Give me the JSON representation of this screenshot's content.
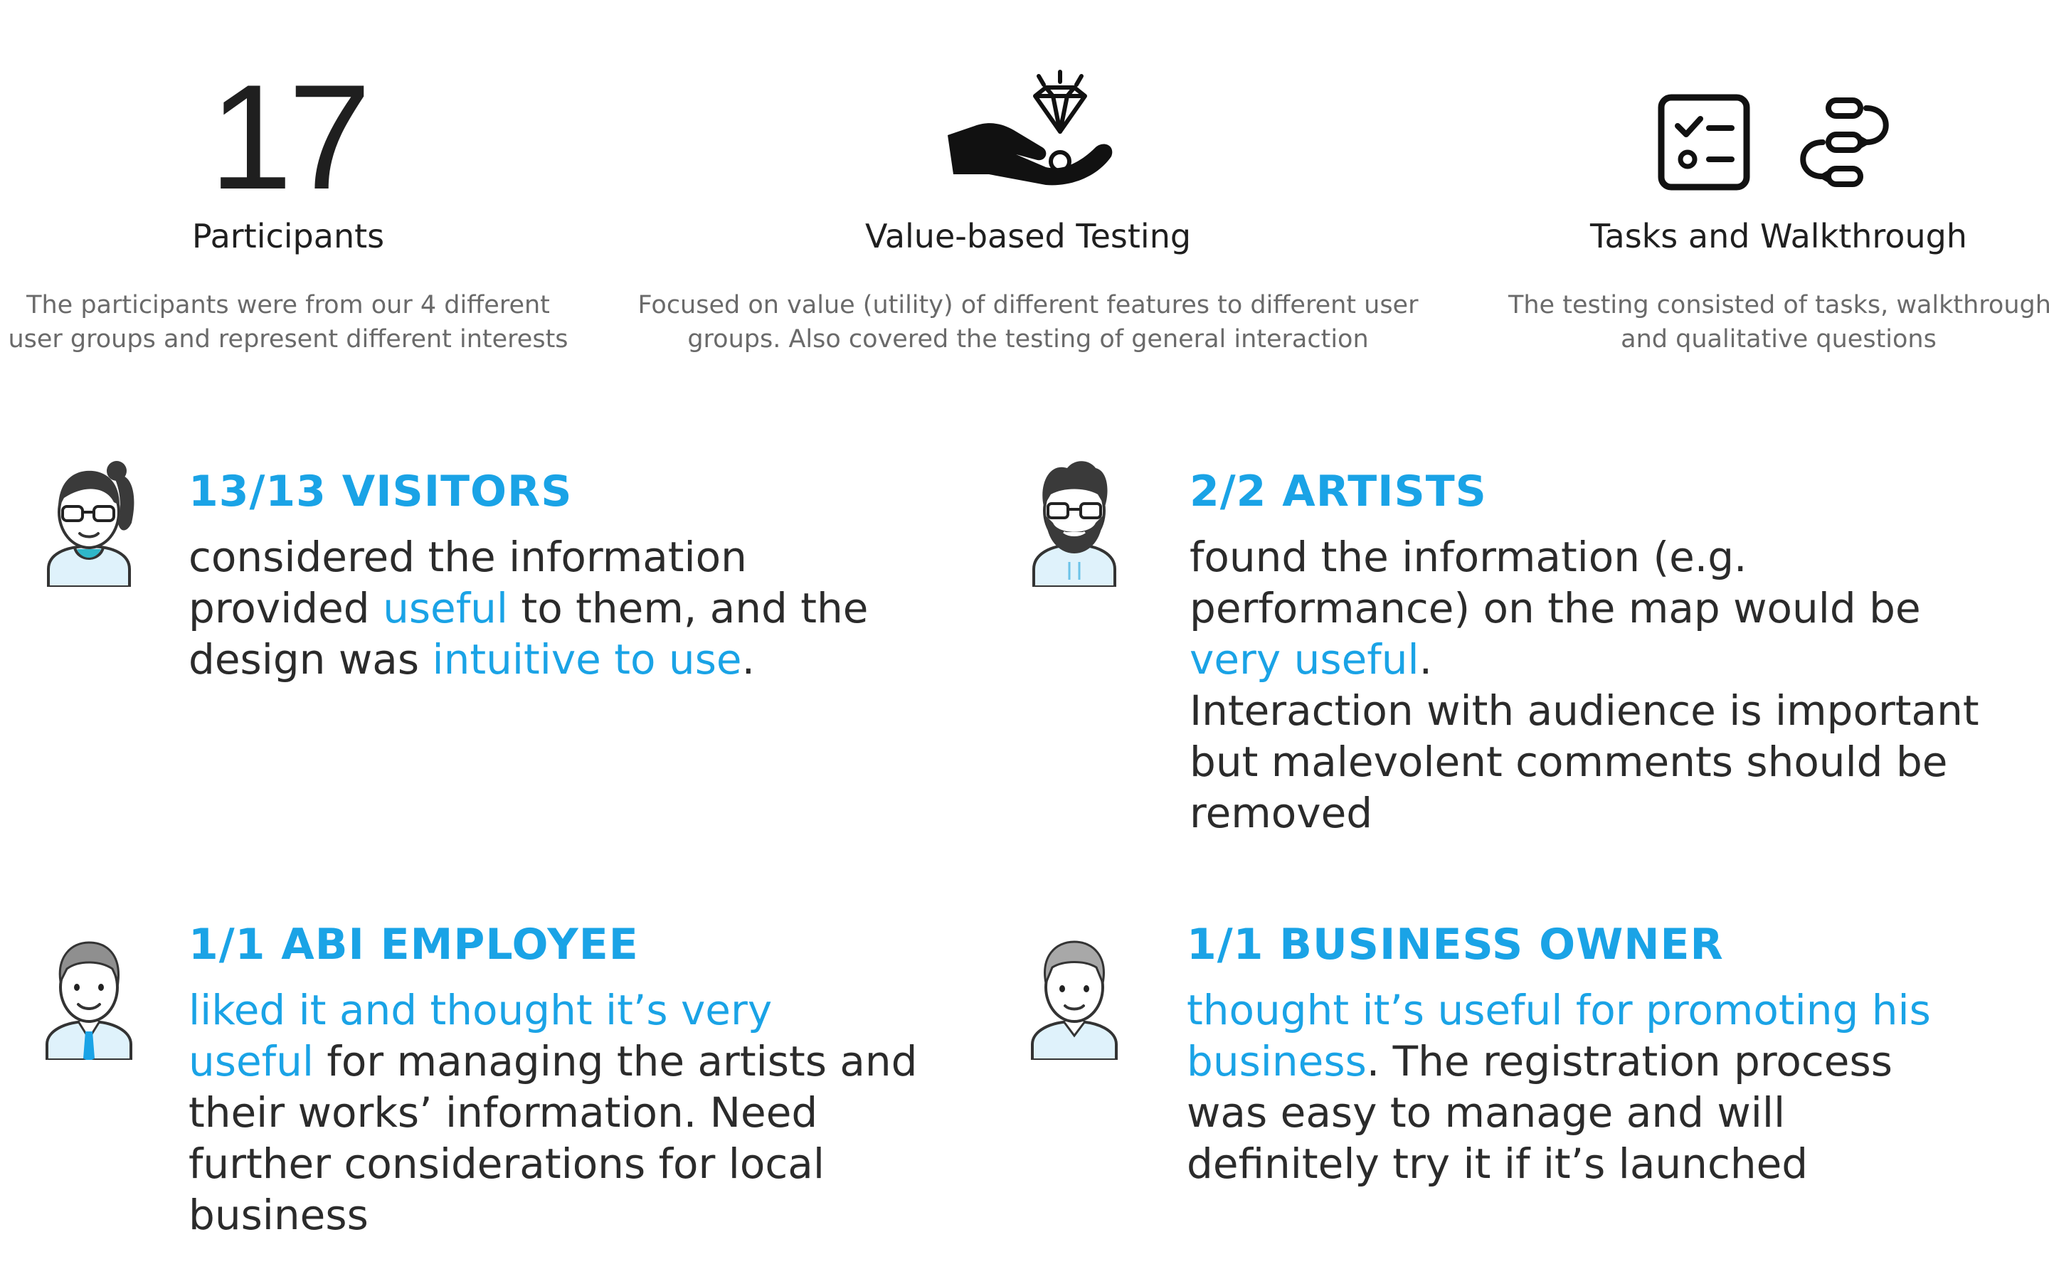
{
  "stats": [
    {
      "number": "17",
      "title": "Participants",
      "desc_lines": [
        "The participants were from our 4 different",
        "user groups and represent different interests"
      ]
    },
    {
      "icon": "hand-diamond-icon",
      "title": "Value-based Testing",
      "desc_lines": [
        "Focused on value (utility) of different features to different user",
        "groups. Also covered the testing of general interaction"
      ]
    },
    {
      "icon": "checklist-icon",
      "icon2": "flow-icon",
      "title": "Tasks and Walkthrough",
      "desc_lines": [
        "The testing consisted of tasks, walkthrough",
        "and qualitative questions"
      ]
    }
  ],
  "cards": [
    {
      "avatar": "woman-avatar-icon",
      "heading": "13/13 VISITORS",
      "lines": [
        [
          {
            "t": "considered the information"
          }
        ],
        [
          {
            "t": "provided "
          },
          {
            "t": "useful",
            "hl": true
          },
          {
            "t": " to them, and the"
          }
        ],
        [
          {
            "t": "design was "
          },
          {
            "t": "intuitive to use",
            "hl": true
          },
          {
            "t": "."
          }
        ]
      ]
    },
    {
      "avatar": "bearded-man-avatar-icon",
      "heading": "2/2 ARTISTS",
      "lines": [
        [
          {
            "t": "found the information (e.g."
          }
        ],
        [
          {
            "t": "performance) on the map would be"
          }
        ],
        [
          {
            "t": "very useful",
            "hl": true
          },
          {
            "t": "."
          }
        ],
        [
          {
            "t": "Interaction with audience is important"
          }
        ],
        [
          {
            "t": "but malevolent comments should be"
          }
        ],
        [
          {
            "t": "removed"
          }
        ]
      ]
    },
    {
      "avatar": "employee-avatar-icon",
      "heading": "1/1 ABI EMPLOYEE",
      "lines": [
        [
          {
            "t": "liked it and thought it’s very",
            "hl": true
          }
        ],
        [
          {
            "t": "useful",
            "hl": true
          },
          {
            "t": " for managing the artists and"
          }
        ],
        [
          {
            "t": "their works’ information.  Need"
          }
        ],
        [
          {
            "t": "further considerations for local"
          }
        ],
        [
          {
            "t": "business"
          }
        ]
      ]
    },
    {
      "avatar": "business-owner-avatar-icon",
      "heading": "1/1 BUSINESS OWNER",
      "lines": [
        [
          {
            "t": "thought it’s useful for promoting his",
            "hl": true
          }
        ],
        [
          {
            "t": "business",
            "hl": true
          },
          {
            "t": ". The registration process"
          }
        ],
        [
          {
            "t": "was easy to manage and will"
          }
        ],
        [
          {
            "t": "definitely try it if it’s launched"
          }
        ]
      ]
    }
  ],
  "colors": {
    "accent": "#1aa3e6",
    "text": "#2b2b2b",
    "muted": "#6a6a6a"
  }
}
